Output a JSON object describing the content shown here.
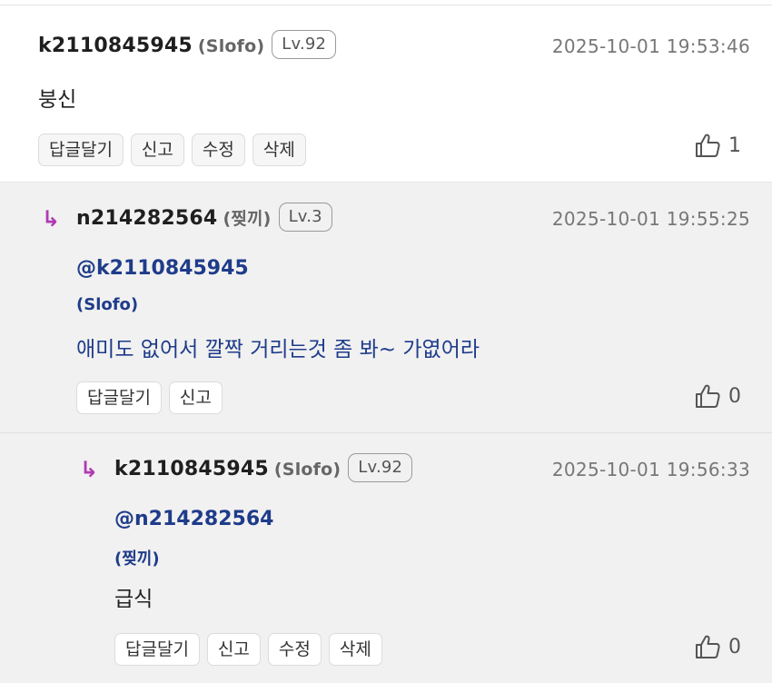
{
  "comments": [
    {
      "user_id": "k2110845945",
      "nickname": "(Slofo)",
      "level": "Lv.92",
      "timestamp": "2025-10-01 19:53:46",
      "text": "붕신",
      "actions": [
        "답글달기",
        "신고",
        "수정",
        "삭제"
      ],
      "likes": "1"
    },
    {
      "reply_arrow": "↳",
      "user_id": "n214282564",
      "nickname": "(찢끼)",
      "level": "Lv.3",
      "timestamp": "2025-10-01 19:55:25",
      "mention": "@k2110845945",
      "mention_nickname": "(Slofo)",
      "text": "애미도 없어서 깔짝 거리는것 좀 봐~ 가엾어라",
      "actions": [
        "답글달기",
        "신고"
      ],
      "likes": "0"
    },
    {
      "reply_arrow": "↳",
      "user_id": "k2110845945",
      "nickname": "(Slofo)",
      "level": "Lv.92",
      "timestamp": "2025-10-01 19:56:33",
      "mention": "@n214282564",
      "mention_nickname": "(찢끼)",
      "text": "급식",
      "actions": [
        "답글달기",
        "신고",
        "수정",
        "삭제"
      ],
      "likes": "0"
    }
  ],
  "colors": {
    "reply_arrow": "#b03ab3",
    "mention": "#1f3c8a",
    "reply_background": "#f1f1f1"
  },
  "icons": {
    "like": "thumbs-up-icon"
  }
}
